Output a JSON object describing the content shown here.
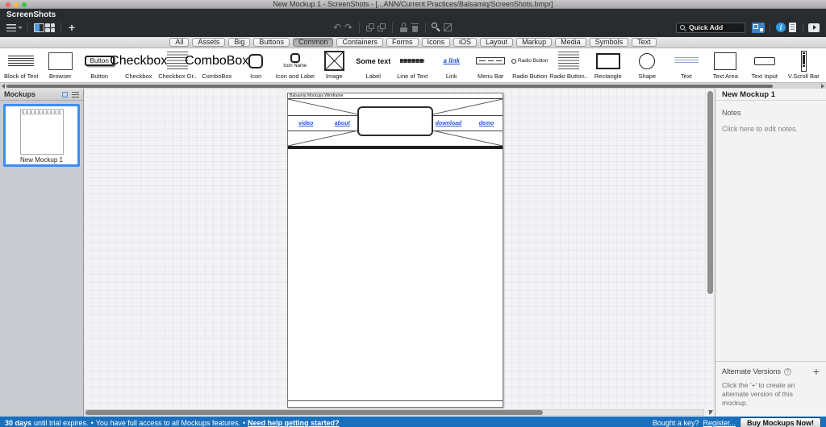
{
  "window": {
    "title": "New Mockup 1 - ScreenShots - [...ANN/Current Practices/Balsamiq/ScreenShots.bmpr]"
  },
  "app_bar": {
    "project": "ScreenShots",
    "quick_add_placeholder": "Quick Add"
  },
  "tabs": {
    "active": "Common",
    "items": [
      "All",
      "Assets",
      "Big",
      "Buttons",
      "Common",
      "Containers",
      "Forms",
      "Icons",
      "iOS",
      "Layout",
      "Markup",
      "Media",
      "Symbols",
      "Text"
    ]
  },
  "library": {
    "items": [
      {
        "label": "Block of Text",
        "kind": "block"
      },
      {
        "label": "Browser",
        "kind": "browser"
      },
      {
        "label": "Button",
        "kind": "button",
        "preview": "Button"
      },
      {
        "label": "Checkbox",
        "kind": "checkbox",
        "preview": "Checkbox"
      },
      {
        "label": "Checkbox Gr...",
        "kind": "group"
      },
      {
        "label": "ComboBox",
        "kind": "combobox",
        "preview": "ComboBox"
      },
      {
        "label": "Icon",
        "kind": "icon"
      },
      {
        "label": "Icon and Label",
        "kind": "iconlabel",
        "preview": "Icon Name"
      },
      {
        "label": "Image",
        "kind": "image"
      },
      {
        "label": "Label",
        "kind": "label",
        "preview": "Some text"
      },
      {
        "label": "Line of Text",
        "kind": "line"
      },
      {
        "label": "Link",
        "kind": "link",
        "preview": "a link"
      },
      {
        "label": "Menu Bar",
        "kind": "menubar"
      },
      {
        "label": "Radio Button",
        "kind": "radio",
        "preview": "Radio Button"
      },
      {
        "label": "Radio Button...",
        "kind": "group"
      },
      {
        "label": "Rectangle",
        "kind": "rect"
      },
      {
        "label": "Shape",
        "kind": "shape"
      },
      {
        "label": "Text",
        "kind": "text"
      },
      {
        "label": "Text Area",
        "kind": "textarea"
      },
      {
        "label": "Text Input",
        "kind": "textinput"
      },
      {
        "label": "V.Scroll Bar",
        "kind": "vscroll"
      }
    ]
  },
  "mockups_panel": {
    "title": "Mockups",
    "items": [
      {
        "name": "New Mockup 1",
        "selected": true
      }
    ]
  },
  "canvas_mockup": {
    "browser_title": "Balsamiq Mockups Wireframe",
    "nav_links_left": [
      "video",
      "about"
    ],
    "nav_links_right": [
      "download",
      "demo"
    ]
  },
  "inspector": {
    "title": "New Mockup 1",
    "notes_heading": "Notes",
    "notes_placeholder": "Click here to edit notes.",
    "alternate_heading": "Alternate Versions",
    "alternate_help": "?",
    "add_symbol": "+",
    "alternate_hint": "Click the '+' to create an alternate version of this mockup."
  },
  "status_bar": {
    "trial_bold": "30 days",
    "trial_rest": "until trial expires.",
    "bullet": "•",
    "access_text": "You have full access to all Mockups features.",
    "help_link": "Need help getting started?",
    "register_prefix": "Bought a key?",
    "register_link": "Register...",
    "buy_button": "Buy Mockups Now!"
  },
  "colors": {
    "selection_blue": "#3d8df5",
    "info_blue": "#2e9be4",
    "status_bar_blue": "#1b70bd",
    "toolbar_dark": "#282c2f"
  }
}
